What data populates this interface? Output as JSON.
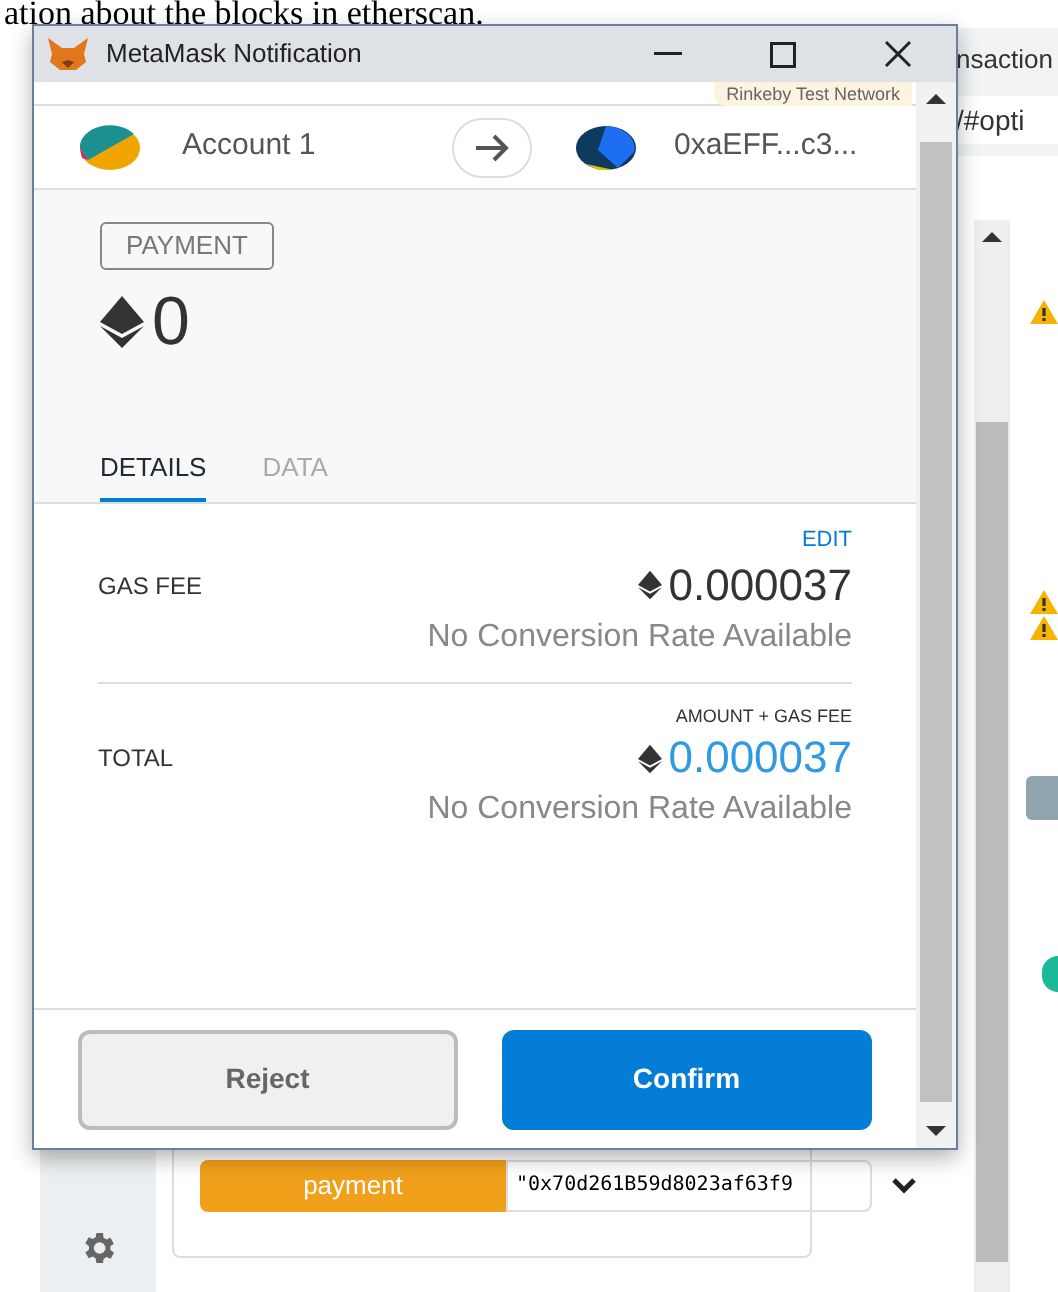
{
  "document_text": "ation about the blocks in etherscan.",
  "browser": {
    "tab_title": "nsaction",
    "address": "/#opti"
  },
  "dapp": {
    "function_button": "payment",
    "argument_value": "\"0x70d261B59d8023af63f9"
  },
  "notification": {
    "title": "MetaMask Notification",
    "network": "Rinkeby Test Network",
    "from_account": "Account 1",
    "to_address": "0xaEFF...c3...",
    "transaction_type": "PAYMENT",
    "amount": "0",
    "tabs": [
      {
        "label": "DETAILS",
        "selected": true
      },
      {
        "label": "DATA",
        "selected": false
      }
    ],
    "rows": [
      {
        "kind": "editable",
        "heading": "EDIT",
        "label": "GAS FEE",
        "value": "0.000037",
        "conversion": "No Conversion Rate Available"
      },
      {
        "kind": "total",
        "heading": "AMOUNT + GAS FEE",
        "label": "TOTAL",
        "value": "0.000037",
        "conversion": "No Conversion Rate Available"
      }
    ],
    "buttons": [
      {
        "kind": "secondary",
        "label": "Reject"
      },
      {
        "kind": "primary",
        "label": "Confirm"
      }
    ]
  }
}
